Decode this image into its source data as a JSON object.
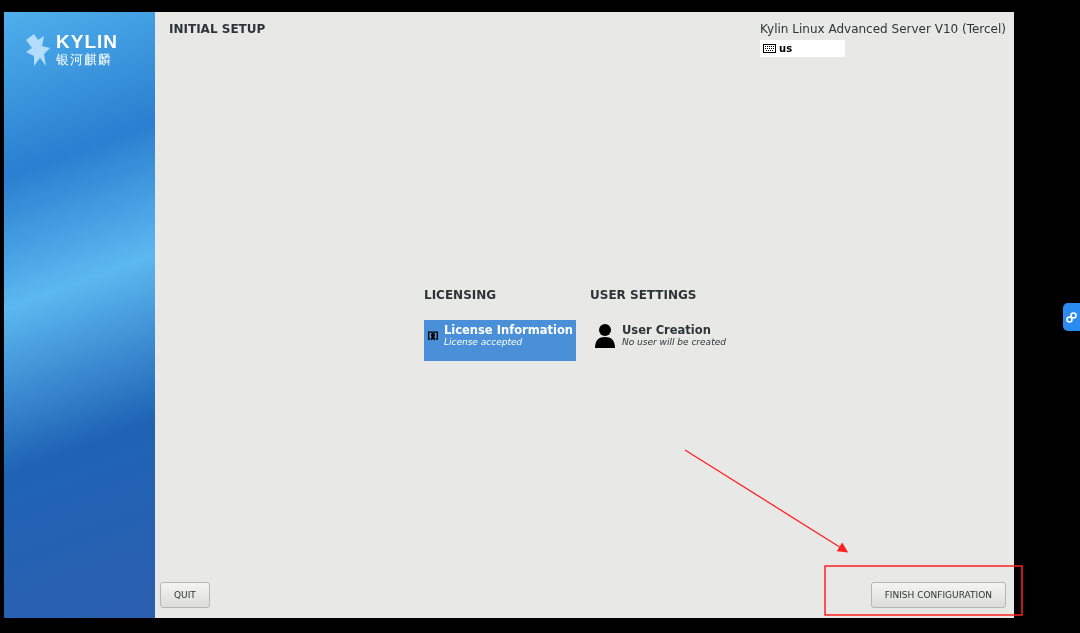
{
  "sidebar": {
    "logo_name": "KYLIN",
    "logo_subtitle": "银河麒麟"
  },
  "header": {
    "title": "INITIAL SETUP",
    "product": "Kylin Linux Advanced Server V10 (Tercel)",
    "keyboard_layout": "us"
  },
  "categories": [
    {
      "title": "LICENSING",
      "spokes": [
        {
          "kind": "license",
          "title": "License Information",
          "status": "License accepted",
          "selected": true
        }
      ]
    },
    {
      "title": "USER SETTINGS",
      "spokes": [
        {
          "kind": "user",
          "title": "User Creation",
          "status": "No user will be created",
          "selected": false
        }
      ]
    }
  ],
  "buttons": {
    "quit": "QUIT",
    "finish": "FINISH CONFIGURATION"
  }
}
